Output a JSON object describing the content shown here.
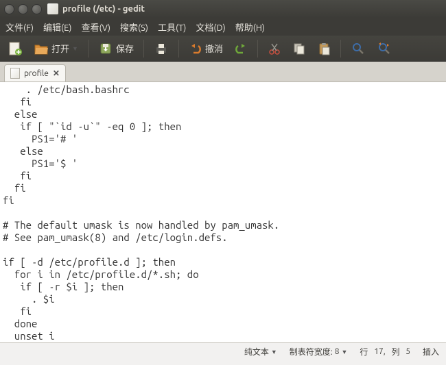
{
  "window": {
    "title": "profile (/etc) - gedit"
  },
  "menubar": {
    "file": "文件(F)",
    "edit": "编辑(E)",
    "view": "查看(V)",
    "search": "搜索(S)",
    "tools": "工具(T)",
    "documents": "文档(D)",
    "help": "帮助(H)"
  },
  "toolbar": {
    "open": "打开",
    "save": "保存",
    "undo": "撤消"
  },
  "tab": {
    "label": "profile"
  },
  "editor": {
    "content": "    . /etc/bash.bashrc\n   fi\n  else\n   if [ \"`id -u`\" -eq 0 ]; then\n     PS1='# '\n   else\n     PS1='$ '\n   fi\n  fi\nfi\n\n# The default umask is now handled by pam_umask.\n# See pam_umask(8) and /etc/login.defs.\n\nif [ -d /etc/profile.d ]; then\n  for i in /etc/profile.d/*.sh; do\n   if [ -r $i ]; then\n     . $i\n   fi\n  done\n  unset i\nfi"
  },
  "statusbar": {
    "filetype": "纯文本",
    "tabwidth_label": "制表符宽度:",
    "tabwidth_value": "8",
    "position_label_row": "行",
    "position_row": "17,",
    "position_label_col": "列",
    "position_col": "5",
    "insert_mode": "插入"
  }
}
